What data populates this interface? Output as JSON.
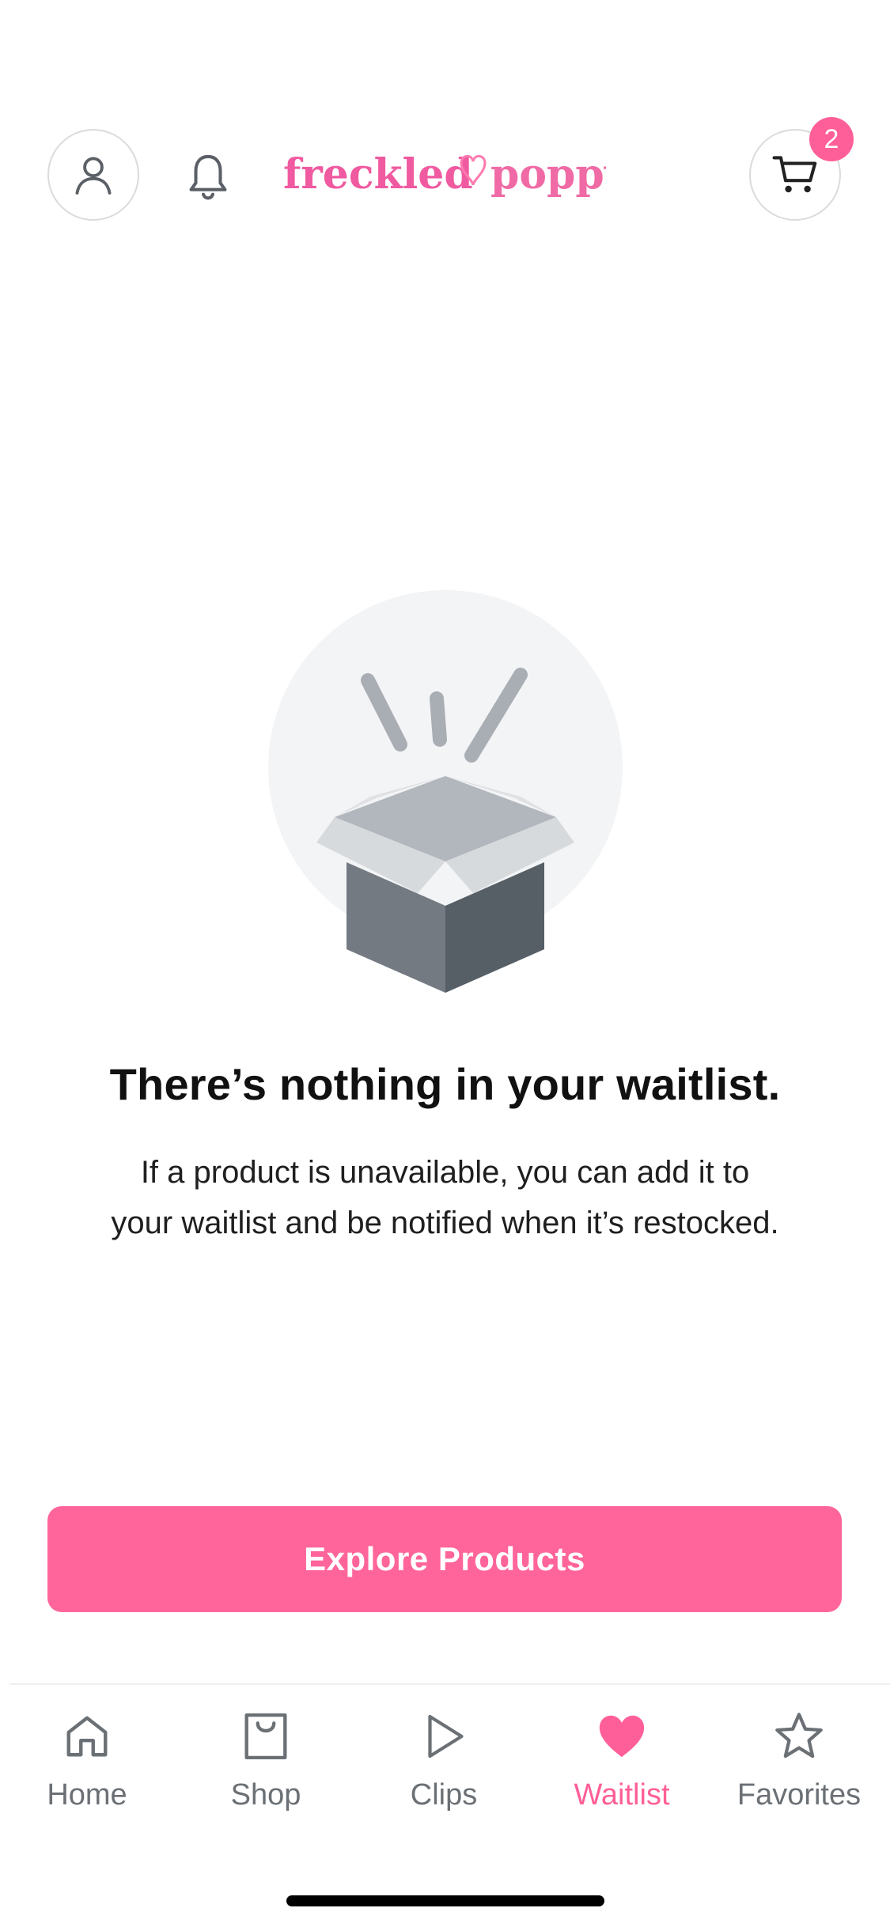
{
  "header": {
    "logo_text": "freckled poppy",
    "cart_count": "2",
    "icons": {
      "profile": "user-icon",
      "notifications": "bell-icon",
      "cart": "cart-icon"
    }
  },
  "empty_state": {
    "illustration": "open-box-illustration",
    "title": "There’s nothing in your waitlist.",
    "description_line1": "If a product is unavailable, you can add it to",
    "description_line2": "your waitlist and be notified when it’s restocked."
  },
  "actions": {
    "explore_label": "Explore Products"
  },
  "bottom_nav": {
    "items": [
      {
        "label": "Home",
        "icon": "home-icon",
        "active": false
      },
      {
        "label": "Shop",
        "icon": "shopping-bag-icon",
        "active": false
      },
      {
        "label": "Clips",
        "icon": "play-icon",
        "active": false
      },
      {
        "label": "Waitlist",
        "icon": "heart-icon",
        "active": true
      },
      {
        "label": "Favorites",
        "icon": "star-icon",
        "active": false
      }
    ]
  },
  "colors": {
    "accent": "#ff659a",
    "icon_gray": "#5a6066",
    "nav_inactive": "#6b7075"
  }
}
